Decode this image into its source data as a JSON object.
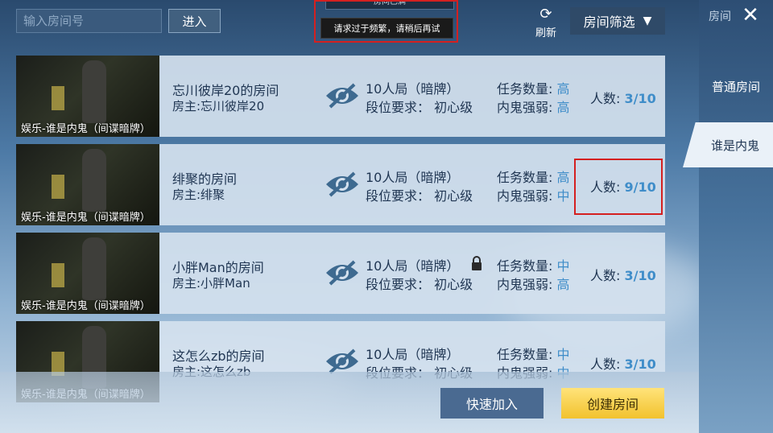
{
  "search": {
    "placeholder": "输入房间号",
    "enter_label": "进入"
  },
  "notices": {
    "room_full": "房间已满",
    "too_frequent": "请求过于频繁，请稍后再试"
  },
  "refresh_label": "刷新",
  "filter_label": "房间筛选",
  "sidebar": {
    "header": "房间",
    "tabs": [
      "普通房间",
      "谁是内鬼"
    ],
    "selected_tab": "谁是内鬼"
  },
  "rooms": [
    {
      "mode": "娱乐-谁是内鬼（间谍暗牌）",
      "name": "忘川彼岸20的房间",
      "host": "房主:忘川彼岸20",
      "format": "10人局（暗牌）",
      "rank_label": "段位要求：",
      "rank_value": "初心级",
      "task_label": "任务数量:",
      "task_value": "高",
      "imp_label": "内鬼强弱:",
      "imp_value": "高",
      "players_label": "人数:",
      "players": "3/10",
      "locked": false
    },
    {
      "mode": "娱乐-谁是内鬼（间谍暗牌）",
      "name": "绯聚的房间",
      "host": "房主:绯聚",
      "format": "10人局（暗牌）",
      "rank_label": "段位要求：",
      "rank_value": "初心级",
      "task_label": "任务数量:",
      "task_value": "高",
      "imp_label": "内鬼强弱:",
      "imp_value": "中",
      "players_label": "人数:",
      "players": "9/10",
      "locked": false
    },
    {
      "mode": "娱乐-谁是内鬼（间谍暗牌）",
      "name": "小胖Man的房间",
      "host": "房主:小胖Man",
      "format": "10人局（暗牌）",
      "rank_label": "段位要求：",
      "rank_value": "初心级",
      "task_label": "任务数量:",
      "task_value": "中",
      "imp_label": "内鬼强弱:",
      "imp_value": "高",
      "players_label": "人数:",
      "players": "3/10",
      "locked": true
    },
    {
      "mode": "娱乐-谁是内鬼（间谍暗牌）",
      "name": "这怎么zb的房间",
      "host": "房主:这怎么zb",
      "format": "10人局（暗牌）",
      "rank_label": "段位要求：",
      "rank_value": "初心级",
      "task_label": "任务数量:",
      "task_value": "中",
      "imp_label": "内鬼强弱:",
      "imp_value": "中",
      "players_label": "人数:",
      "players": "3/10",
      "locked": false
    }
  ],
  "buttons": {
    "quick_join": "快速加入",
    "create_room": "创建房间"
  },
  "colors": {
    "highlight": "#d42020",
    "level": "#3f8dc9",
    "create": "#f2c22e"
  }
}
